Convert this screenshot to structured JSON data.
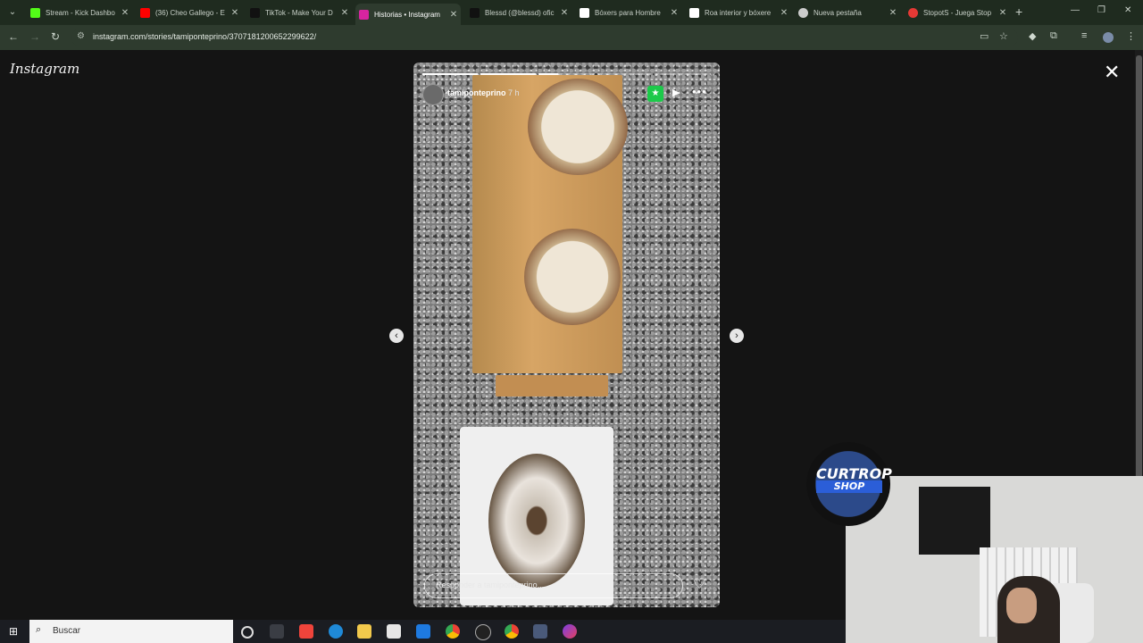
{
  "browser": {
    "tabs": [
      {
        "title": "Stream - Kick Dashbo",
        "favicon_color": "#53fc18",
        "active": false
      },
      {
        "title": "(36) Cheo Gallego - E",
        "favicon_color": "#ff0000",
        "active": false
      },
      {
        "title": "TikTok - Make Your D",
        "favicon_color": "#111111",
        "active": false
      },
      {
        "title": "Historias • Instagram",
        "favicon_color": "#d6249f",
        "active": true
      },
      {
        "title": "Blessd (@blessd) ofic",
        "favicon_color": "#111111",
        "active": false
      },
      {
        "title": "Bóxers para Hombre",
        "favicon_color": "#ffffff",
        "active": false
      },
      {
        "title": "Roa interior y bóxere",
        "favicon_color": "#ffffff",
        "active": false
      },
      {
        "title": "Nueva pestaña",
        "favicon_color": "#cccccc",
        "active": false
      },
      {
        "title": "StopotS - Juega Stop",
        "favicon_color": "#e53935",
        "active": false
      }
    ],
    "tab_close_glyph": "✕",
    "new_tab_glyph": "+",
    "url": "instagram.com/stories/tamiponteprino/3707181200652299622/"
  },
  "page": {
    "logo_text": "Instagram",
    "close_glyph": "✕",
    "story": {
      "username": "tamiponteprino",
      "time_ago": "7 h",
      "progress_segments": [
        1,
        1,
        0.35,
        0,
        0
      ],
      "reply_placeholder": "Responder a tamiponteprino...",
      "prev_glyph": "‹",
      "next_glyph": "›"
    }
  },
  "overlay": {
    "badge_line1": "CURTROP",
    "badge_line2": "SHOP"
  },
  "taskbar": {
    "search_label": "Buscar",
    "apps": [
      "task-view-icon",
      "anydesk-icon",
      "edge-icon",
      "file-explorer-icon",
      "store-icon",
      "mail-icon",
      "chrome-icon",
      "obs-icon",
      "chrome-active-icon",
      "calculator-icon",
      "messenger-icon"
    ]
  }
}
